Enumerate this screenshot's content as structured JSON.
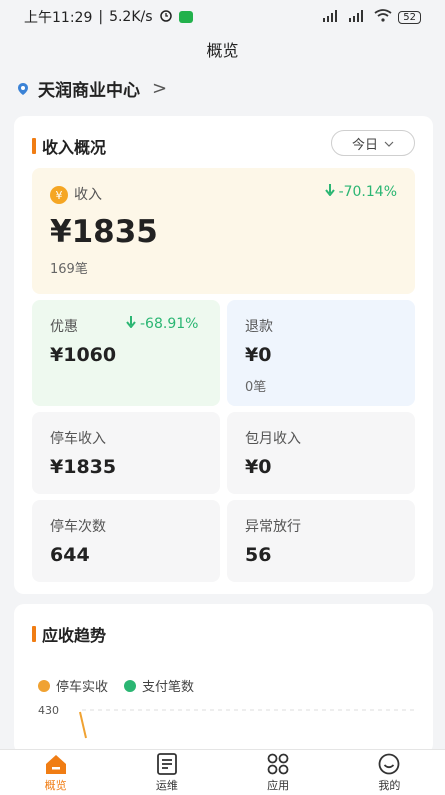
{
  "status_bar": {
    "time": "上午11:29",
    "speed": "5.2K/s",
    "battery": "52"
  },
  "nav": {
    "title": "概览"
  },
  "location": {
    "name": "天润商业中心"
  },
  "overview": {
    "title": "收入概况",
    "range_select": "今日",
    "income": {
      "label": "收入",
      "amount": "¥1835",
      "count": "169笔",
      "trend": "-70.14%"
    },
    "tiles": {
      "discount": {
        "label": "优惠",
        "value": "¥1060",
        "trend": "-68.91%"
      },
      "refund": {
        "label": "退款",
        "value": "¥0",
        "sub": "0笔"
      },
      "parking_income": {
        "label": "停车收入",
        "value": "¥1835"
      },
      "monthly_income": {
        "label": "包月收入",
        "value": "¥0"
      },
      "parking_count": {
        "label": "停车次数",
        "value": "644"
      },
      "abnormal_release": {
        "label": "异常放行",
        "value": "56"
      }
    }
  },
  "trend": {
    "title": "应收趋势",
    "legend": [
      {
        "name": "停车实收",
        "color": "#f0a232"
      },
      {
        "name": "支付笔数",
        "color": "#2bb673"
      }
    ],
    "y_tick": "430"
  },
  "tabs": [
    {
      "label": "概览",
      "icon": "home-icon",
      "active": true
    },
    {
      "label": "运维",
      "icon": "clipboard-icon",
      "active": false
    },
    {
      "label": "应用",
      "icon": "grid-icon",
      "active": false
    },
    {
      "label": "我的",
      "icon": "smile-icon",
      "active": false
    }
  ],
  "colors": {
    "accent": "#f07d14",
    "down": "#2bb673"
  }
}
